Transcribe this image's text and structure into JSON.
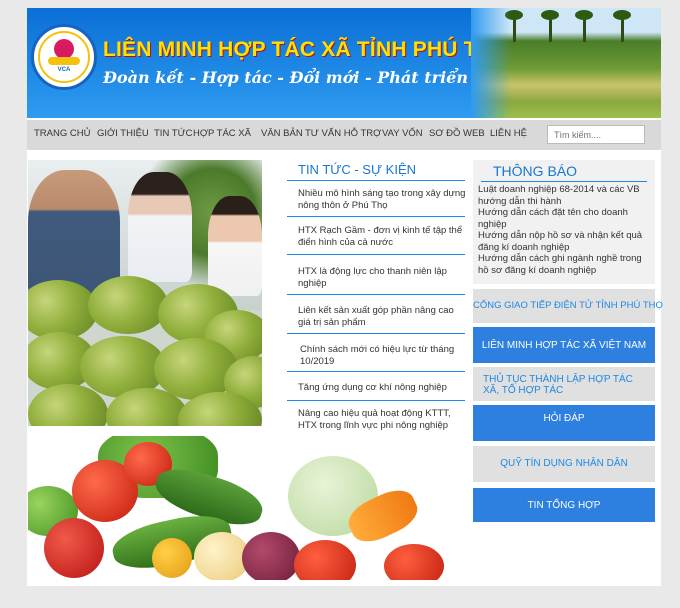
{
  "header": {
    "title": "LIÊN MINH HỢP TÁC XÃ TỈNH PHÚ THỌ",
    "slogan": "Đoàn kết - Hợp tác - Đổi mới - Phát triển bền vững",
    "logo_text": "VCA"
  },
  "nav": {
    "items": [
      "TRANG CHỦ",
      "GIỚI THIỆU",
      "TIN TỨC",
      "HỢP TÁC XÃ",
      "VĂN BẢN",
      "TƯ VẤN HỖ TRỢ",
      "VAY VỐN",
      "SƠ ĐỒ WEB",
      "LIÊN HỆ"
    ],
    "search_placeholder": "Tìm kiếm...."
  },
  "news": {
    "heading": "TIN TỨC - SỰ KIỆN",
    "items": [
      "Nhiều mô hình sáng tạo trong xây dựng nông thôn ở Phú Thọ",
      "HTX Rạch Gầm - đơn vị kinh tế tập thể điển hình của cả nước",
      "HTX là động lực cho thanh niên lập nghiệp",
      "Liên kết sản xuất góp phần nâng cao giá trị sản phẩm",
      "Chính sách mới có hiệu lực từ tháng 10/2019",
      "Tăng ứng dụng cơ khí nông nghiệp",
      "Nâng cao hiệu quả hoạt động KTTT, HTX trong lĩnh vực phi nông nghiệp"
    ]
  },
  "notice": {
    "heading": "THÔNG BÁO",
    "items": [
      "Luật doanh nghiệp 68-2014 và các VB hướng dẫn thi hành",
      "Hướng dẫn cách đặt tên cho doanh nghiệp",
      "Hướng dẫn nộp hồ sơ và nhận kết quả đăng kí doanh nghiệp",
      "Hướng dẫn cách ghi ngành nghề trong hồ sơ đăng kí doanh nghiệp"
    ]
  },
  "sidebar": {
    "links": [
      "CỔNG GIAO TIẾP ĐIỆN TỬ TỈNH PHÚ THỌ",
      "LIÊN MINH HỢP TÁC XÃ VIỆT NAM",
      "THỦ TỤC THÀNH LẬP HỢP TÁC XÃ, TỔ HỢP TÁC",
      "HỎI ĐÁP",
      "QUỸ TÍN DỤNG NHÂN DÂN",
      "TIN TỔNG HỢP"
    ]
  },
  "colors": {
    "accent": "#1e88e5",
    "banner_title": "#ffe000",
    "button_blue": "#2d7fe0"
  }
}
